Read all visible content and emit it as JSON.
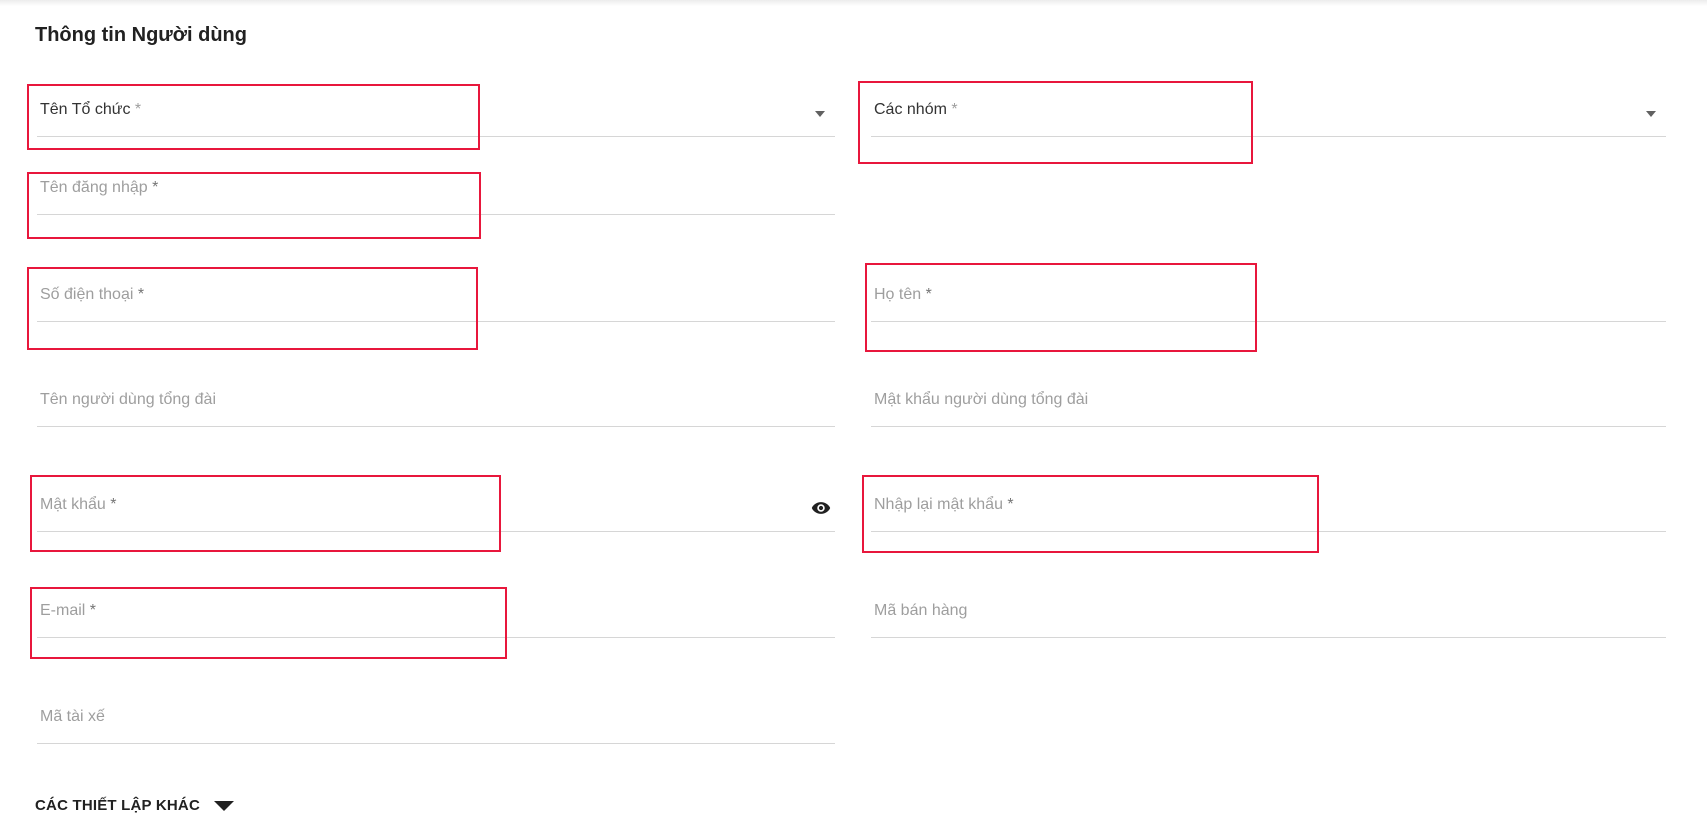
{
  "section": {
    "title": "Thông tin Người dùng"
  },
  "fields": {
    "organization": {
      "label": "Tên Tổ chức",
      "required": "*"
    },
    "groups": {
      "label": "Các nhóm",
      "required": "*"
    },
    "username": {
      "label": "Tên đăng nhập",
      "required": "*"
    },
    "phone": {
      "label": "Số điện thoại",
      "required": "*"
    },
    "full_name": {
      "label": "Họ tên",
      "required": "*"
    },
    "pbx_user": {
      "label": "Tên người dùng tổng đài"
    },
    "pbx_password": {
      "label": "Mật khẩu người dùng tổng đài"
    },
    "password": {
      "label": "Mật khẩu",
      "required": "*"
    },
    "confirm_password": {
      "label": "Nhập lại mật khẩu",
      "required": "*"
    },
    "email": {
      "label": "E-mail",
      "required": "*"
    },
    "sales_code": {
      "label": "Mã bán hàng"
    },
    "driver_code": {
      "label": "Mã tài xế"
    }
  },
  "other_settings": {
    "label": "CÁC THIẾT LẬP KHÁC"
  },
  "icons": {
    "organization_dropdown": "chevron-down-icon",
    "groups_dropdown": "chevron-down-icon",
    "password_visibility": "eye-icon",
    "other_settings_toggle": "caret-down-icon"
  },
  "colors": {
    "highlight": "#e8173c",
    "label": "#9e9e9e",
    "underline": "#d6d6d6",
    "text": "#212121"
  }
}
